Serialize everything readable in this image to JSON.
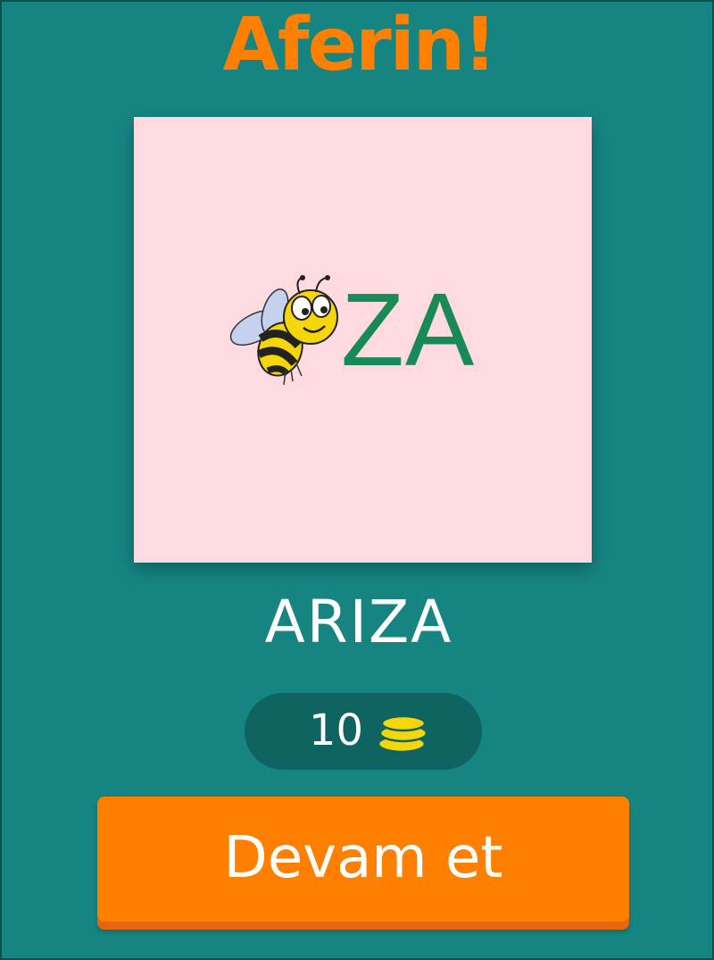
{
  "header": {
    "title": "Aferin!"
  },
  "puzzle": {
    "picture_icon": "bee-icon",
    "picture_letters": "ZA",
    "background_color": "#ffdbe1",
    "letters_color": "#178a58"
  },
  "answer": {
    "word": "ARIZA"
  },
  "reward": {
    "amount": "10",
    "icon": "coins-icon"
  },
  "actions": {
    "continue_label": "Devam et"
  },
  "colors": {
    "background": "#168582",
    "accent": "#ff7f00",
    "reward_pill": "#0f6361"
  }
}
